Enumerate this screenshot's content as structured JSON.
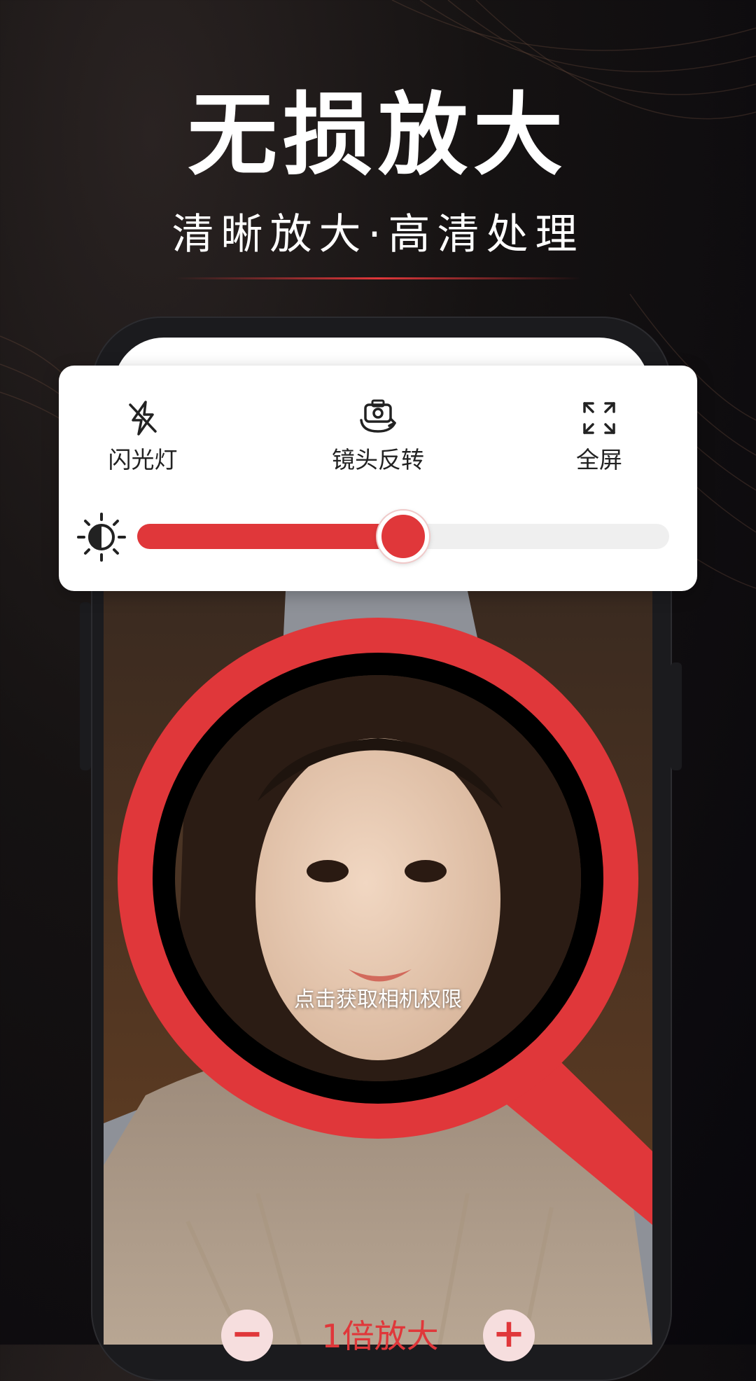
{
  "promo": {
    "headline": "无损放大",
    "subtitle": "清晰放大·高清处理"
  },
  "controls": {
    "flash": {
      "label": "闪光灯",
      "icon": "flash-off-icon"
    },
    "flip": {
      "label": "镜头反转",
      "icon": "camera-flip-icon"
    },
    "fullscreen": {
      "label": "全屏",
      "icon": "fullscreen-icon"
    },
    "brightness": {
      "icon": "brightness-icon",
      "level": 0.5
    }
  },
  "magnifier": {
    "prompt": "点击获取相机权限"
  },
  "zoom": {
    "minus": "−",
    "plus": "+",
    "label": "1倍放大"
  },
  "colors": {
    "accent": "#e0373a",
    "card": "#ffffff",
    "background": "#151212"
  }
}
